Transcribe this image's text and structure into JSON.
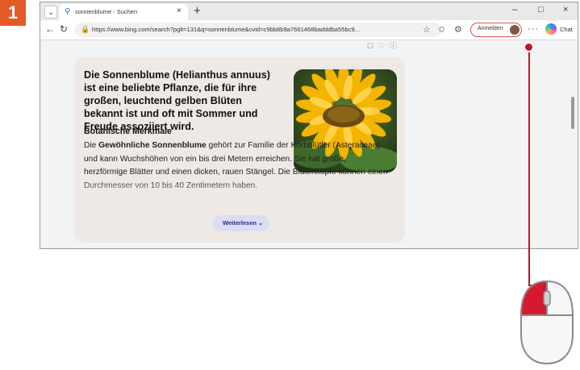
{
  "step": "1",
  "browser": {
    "tab_title": "sonnenblume - Suchen",
    "tab_close": "×",
    "new_tab": "+",
    "window_controls": [
      "–",
      "□",
      "×"
    ],
    "url": "https://www.bing.com/search?pglt=131&q=sonnenblume&cvid=c9bb8b9a7661468badddba55bc9...",
    "signin_label": "Anmelden",
    "more_label": "···",
    "chat_label": "Chat"
  },
  "card": {
    "headline": "Die Sonnenblume (Helianthus annuus) ist eine beliebte Pflanze, die für ihre großen, leuchtend gelben Blüten bekannt ist und oft mit Sommer und Freude assoziiert wird.",
    "section_title": "Botanische Merkmale",
    "para_pre": "Die ",
    "para_bold": "Gewöhnliche Sonnenblume",
    "para_rest": " gehört zur Familie der Korbblütler (Asteraceae) und kann Wuchshöhen von ein bis drei Metern erreichen. Sie hat große, herzförmige Blätter und einen dicken, rauen Stängel. Die Blütenköpfe können einen Durchmesser von 10 bis 40 Zentimetern haben.",
    "more_button": "Weiterlesen ⌄"
  },
  "colors": {
    "accent": "#e35a27",
    "pointer": "#c8102e"
  }
}
